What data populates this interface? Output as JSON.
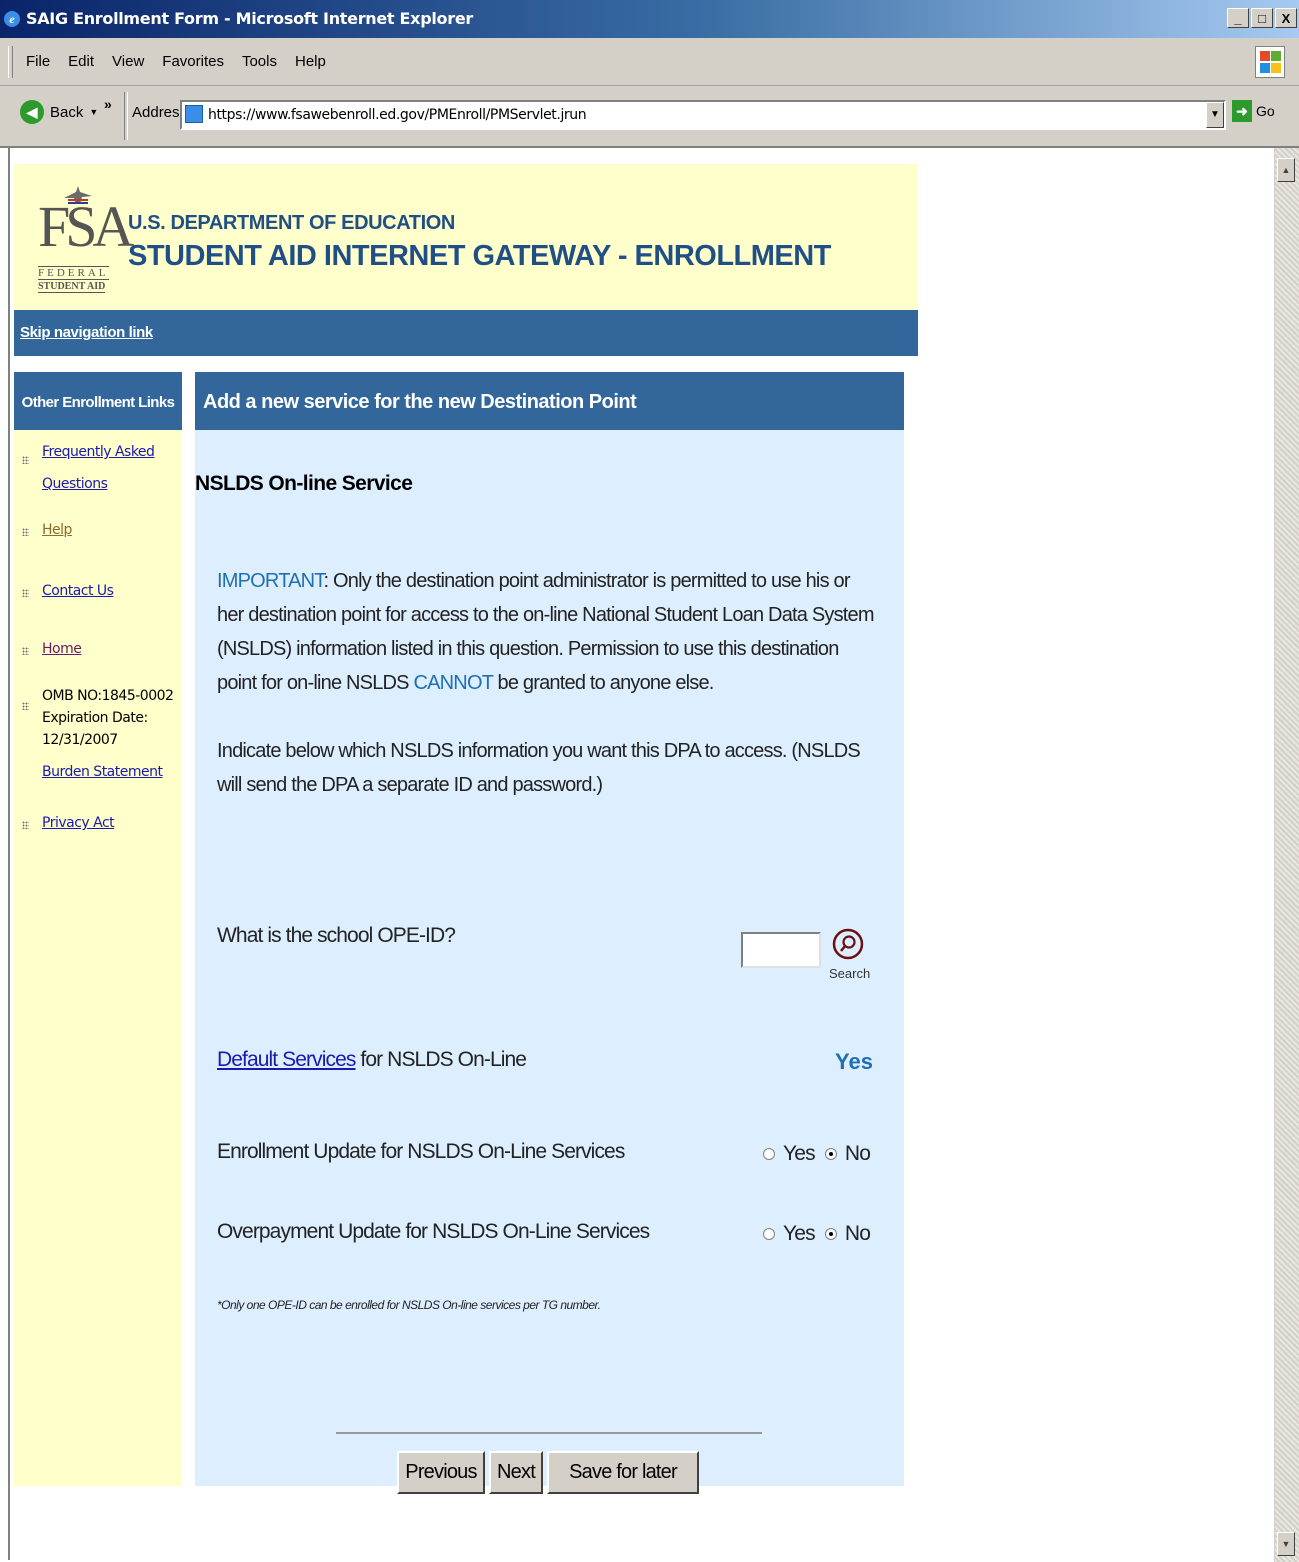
{
  "window": {
    "title": "SAIG Enrollment Form - Microsoft Internet Explorer",
    "buttons": [
      "_",
      "□",
      "X"
    ]
  },
  "menu": [
    "File",
    "Edit",
    "View",
    "Favorites",
    "Tools",
    "Help"
  ],
  "toolbar": {
    "back_label": "Back",
    "address_label": "Address",
    "url": "https://www.fsawebenroll.ed.gov/PMEnroll/PMServlet.jrun",
    "go_label": "Go"
  },
  "header": {
    "logo_letters": "FSA",
    "logo_federal": "FEDERAL",
    "logo_student_aid": "STUDENT AID",
    "dept": "U.S. DEPARTMENT OF EDUCATION",
    "gateway": "STUDENT AID INTERNET GATEWAY - ENROLLMENT"
  },
  "skip_link": "Skip navigation link",
  "sidebar": {
    "title": "Other Enrollment Links",
    "faq_line1": "Frequently Asked",
    "faq_line2": "Questions",
    "help": "Help",
    "contact": "Contact Us",
    "home": "Home",
    "omb": "OMB NO:1845-0002",
    "exp_label": "Expiration Date:",
    "exp_date": "12/31/2007",
    "burden": "Burden Statement",
    "privacy": "Privacy Act"
  },
  "main": {
    "header": "Add a new service for the new Destination Point",
    "section_title": "NSLDS On-line Service",
    "important_label": "IMPORTANT",
    "important_text_1": ": Only the destination point administrator is permitted to use his or her destination point for access to the on-line National Student Loan Data System (NSLDS) information listed in this question. Permission to use this destination point for on-line NSLDS ",
    "cannot": "CANNOT",
    "important_text_2": " be granted to anyone else.",
    "indicate_text": "Indicate below which NSLDS information you want this DPA to access. (NSLDS will send the DPA a separate ID and password.)",
    "ope_question": "What is the school OPE-ID?",
    "ope_value": "",
    "search_label": "Search",
    "default_link": "Default Services",
    "default_suffix": " for NSLDS On-Line",
    "default_value": "Yes",
    "enrollment_label": "Enrollment Update for NSLDS On-Line Services",
    "overpayment_label": "Overpayment Update for NSLDS On-Line Services",
    "yes": "Yes",
    "no": "No",
    "enrollment_selected": "No",
    "overpayment_selected": "No",
    "footnote": "*Only one OPE-ID can be enrolled for NSLDS On-line services per TG number."
  },
  "buttons": {
    "previous": "Previous",
    "next": "Next",
    "save": "Save for later"
  },
  "colors": {
    "header_bg": "#ffffcc",
    "nav_blue": "#33669a",
    "content_bg": "#ddeeff",
    "link": "#1a1ab0",
    "accent": "#1f6fb3"
  }
}
